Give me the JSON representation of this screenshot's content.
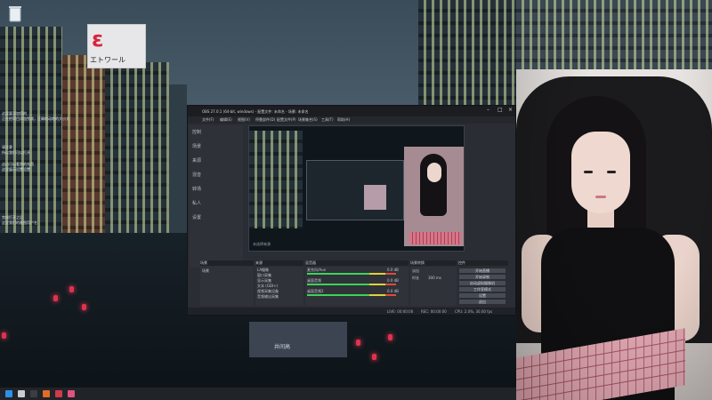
{
  "desktop": {
    "sign": {
      "logo": "ε",
      "text": "エトワール"
    },
    "notes": [
      "这里要添加您的",
      "正在把项目添加完成，正确地动地的大小大",
      "请注意",
      "所以我们可以打开",
      "这边可以看到的东西",
      "这里展示设置设置",
      "完成打开之后",
      "这里我们的截图用户名"
    ],
    "boat_text": "井间高"
  },
  "obs": {
    "title": "OBS 27.0.1 (64-bit, windows) - 配置文件: 未命名 - 场景: 未命名",
    "menu": [
      "文件(F)",
      "编辑(E)",
      "视图(V)",
      "停靠部件(D)",
      "配置文件(P)",
      "场景集合(S)",
      "工具(T)",
      "帮助(H)"
    ],
    "side_items": [
      "控制",
      "场景",
      "来源",
      "混音",
      "转场",
      "私人",
      "设置"
    ],
    "docks": {
      "scenes": {
        "title": "场景",
        "items": [
          "场景"
        ]
      },
      "sources": {
        "title": "来源",
        "items": [
          "LA摄像",
          "窗口采集",
          "显示采集",
          "文本 (GDI+)",
          "视频采集设备",
          "音频输出采集"
        ]
      },
      "mixer": {
        "title": "混音器",
        "channels": [
          {
            "name": "麦克风/Aux",
            "level": "0.0 dB"
          },
          {
            "name": "桌面音频",
            "level": "0.0 dB"
          },
          {
            "name": "桌面音频2",
            "level": "0.0 dB"
          }
        ]
      },
      "transitions": {
        "title": "场景转换",
        "type": "淡出",
        "duration_label": "时长",
        "duration": "300 ms"
      },
      "controls": {
        "title": "控件",
        "buttons": [
          "开始直播",
          "开始录制",
          "启动虚拟摄像机",
          "工作室模式",
          "设置",
          "退出"
        ]
      }
    },
    "preview_label": "未选择来源",
    "status": [
      "LIVE: 00:00:00",
      "REC: 00:00:00",
      "CPU: 2.0%, 30.00 fps"
    ]
  },
  "taskbar": {
    "icons": [
      {
        "name": "windows-start-icon",
        "color": "#2f8fe8"
      },
      {
        "name": "search-icon",
        "color": "#c9ccd0"
      },
      {
        "name": "obs-app-icon",
        "color": "#3a3d44"
      },
      {
        "name": "browser-icon",
        "color": "#e06c2a"
      },
      {
        "name": "app-icon-red",
        "color": "#d03a4a"
      },
      {
        "name": "app-icon-pink",
        "color": "#e2517f"
      }
    ]
  }
}
